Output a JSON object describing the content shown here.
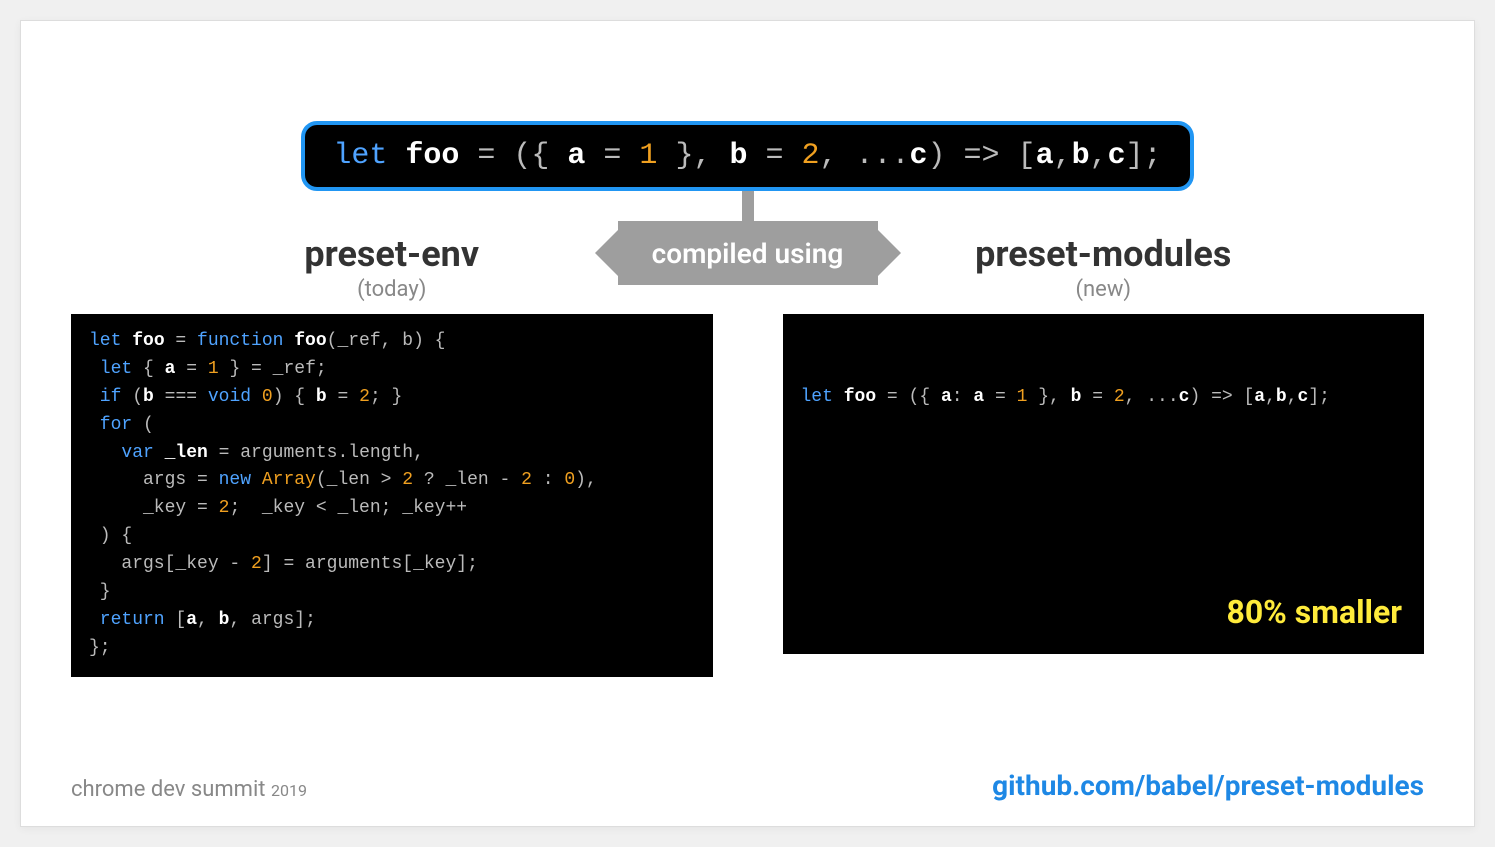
{
  "source": {
    "tokens": [
      {
        "t": "let ",
        "c": "kw"
      },
      {
        "t": "foo",
        "c": "id"
      },
      {
        "t": " = ({ ",
        "c": "pun"
      },
      {
        "t": "a",
        "c": "id"
      },
      {
        "t": " = ",
        "c": "pun"
      },
      {
        "t": "1",
        "c": "num"
      },
      {
        "t": " }, ",
        "c": "pun"
      },
      {
        "t": "b",
        "c": "id"
      },
      {
        "t": " = ",
        "c": "pun"
      },
      {
        "t": "2",
        "c": "num"
      },
      {
        "t": ", ...",
        "c": "pun"
      },
      {
        "t": "c",
        "c": "id"
      },
      {
        "t": ") => [",
        "c": "pun"
      },
      {
        "t": "a",
        "c": "id"
      },
      {
        "t": ",",
        "c": "pun"
      },
      {
        "t": "b",
        "c": "id"
      },
      {
        "t": ",",
        "c": "pun"
      },
      {
        "t": "c",
        "c": "id"
      },
      {
        "t": "];",
        "c": "pun"
      }
    ]
  },
  "connector_label": "compiled using",
  "left": {
    "title": "preset-env",
    "subtitle": "(today)",
    "lines": [
      [
        {
          "t": "let ",
          "c": "kw"
        },
        {
          "t": "foo",
          "c": "id"
        },
        {
          "t": " = ",
          "c": "pun"
        },
        {
          "t": "function ",
          "c": "kw"
        },
        {
          "t": "foo",
          "c": "id"
        },
        {
          "t": "(_ref, b) {",
          "c": "pun"
        }
      ],
      [
        {
          "t": " let ",
          "c": "kw"
        },
        {
          "t": "{ ",
          "c": "pun"
        },
        {
          "t": "a",
          "c": "id"
        },
        {
          "t": " = ",
          "c": "pun"
        },
        {
          "t": "1",
          "c": "num"
        },
        {
          "t": " } = _ref;",
          "c": "pun"
        }
      ],
      [
        {
          "t": " if ",
          "c": "kw"
        },
        {
          "t": "(",
          "c": "pun"
        },
        {
          "t": "b",
          "c": "id"
        },
        {
          "t": " === ",
          "c": "pun"
        },
        {
          "t": "void ",
          "c": "kw"
        },
        {
          "t": "0",
          "c": "num"
        },
        {
          "t": ") { ",
          "c": "pun"
        },
        {
          "t": "b",
          "c": "id"
        },
        {
          "t": " = ",
          "c": "pun"
        },
        {
          "t": "2",
          "c": "num"
        },
        {
          "t": "; }",
          "c": "pun"
        }
      ],
      [
        {
          "t": " for ",
          "c": "kw"
        },
        {
          "t": "(",
          "c": "pun"
        }
      ],
      [
        {
          "t": "   var ",
          "c": "kw"
        },
        {
          "t": "_len",
          "c": "id"
        },
        {
          "t": " = arguments.length,",
          "c": "pun"
        }
      ],
      [
        {
          "t": "     args = ",
          "c": "pun"
        },
        {
          "t": "new ",
          "c": "kw"
        },
        {
          "t": "Array",
          "c": "num"
        },
        {
          "t": "(_len > ",
          "c": "pun"
        },
        {
          "t": "2",
          "c": "num"
        },
        {
          "t": " ? _len - ",
          "c": "pun"
        },
        {
          "t": "2",
          "c": "num"
        },
        {
          "t": " : ",
          "c": "pun"
        },
        {
          "t": "0",
          "c": "num"
        },
        {
          "t": "),",
          "c": "pun"
        }
      ],
      [
        {
          "t": "     _key = ",
          "c": "pun"
        },
        {
          "t": "2",
          "c": "num"
        },
        {
          "t": ";  _key < _len; _key++",
          "c": "pun"
        }
      ],
      [
        {
          "t": " ) {",
          "c": "pun"
        }
      ],
      [
        {
          "t": "   args[_key - ",
          "c": "pun"
        },
        {
          "t": "2",
          "c": "num"
        },
        {
          "t": "] = arguments[_key];",
          "c": "pun"
        }
      ],
      [
        {
          "t": " }",
          "c": "pun"
        }
      ],
      [
        {
          "t": " return ",
          "c": "kw"
        },
        {
          "t": "[",
          "c": "pun"
        },
        {
          "t": "a",
          "c": "id"
        },
        {
          "t": ", ",
          "c": "pun"
        },
        {
          "t": "b",
          "c": "id"
        },
        {
          "t": ", args];",
          "c": "pun"
        }
      ],
      [
        {
          "t": "};",
          "c": "pun"
        }
      ]
    ]
  },
  "right": {
    "title": "preset-modules",
    "subtitle": "(new)",
    "lines": [
      [
        {
          "t": "let ",
          "c": "kw"
        },
        {
          "t": "foo",
          "c": "id"
        },
        {
          "t": " = ({ ",
          "c": "pun"
        },
        {
          "t": "a",
          "c": "id"
        },
        {
          "t": ": ",
          "c": "pun"
        },
        {
          "t": "a",
          "c": "id"
        },
        {
          "t": " = ",
          "c": "pun"
        },
        {
          "t": "1",
          "c": "num"
        },
        {
          "t": " }, ",
          "c": "pun"
        },
        {
          "t": "b",
          "c": "id"
        },
        {
          "t": " = ",
          "c": "pun"
        },
        {
          "t": "2",
          "c": "num"
        },
        {
          "t": ", ...",
          "c": "pun"
        },
        {
          "t": "c",
          "c": "id"
        },
        {
          "t": ") => [",
          "c": "pun"
        },
        {
          "t": "a",
          "c": "id"
        },
        {
          "t": ",",
          "c": "pun"
        },
        {
          "t": "b",
          "c": "id"
        },
        {
          "t": ",",
          "c": "pun"
        },
        {
          "t": "c",
          "c": "id"
        },
        {
          "t": "];",
          "c": "pun"
        }
      ]
    ],
    "badge": "80% smaller"
  },
  "footer": {
    "event": "chrome dev summit",
    "year": "2019",
    "link": "github.com/babel/preset-modules"
  }
}
